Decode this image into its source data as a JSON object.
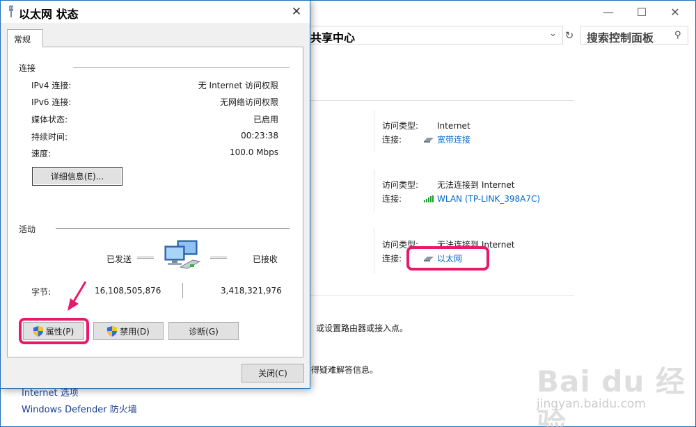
{
  "background_window": {
    "address": "共享中心",
    "search_placeholder": "搜索控制面板",
    "controls": {
      "minimize": "—",
      "maximize": "☐",
      "close": "✕"
    },
    "networks": [
      {
        "access_type_label": "访问类型:",
        "access_type": "Internet",
        "connection_label": "连接:",
        "connection": "宽带连接",
        "icon": "broadband-icon"
      },
      {
        "access_type_label": "访问类型:",
        "access_type": "无法连接到 Internet",
        "connection_label": "连接:",
        "connection": "WLAN (TP-LINK_398A7C)",
        "icon": "wifi-signal-icon"
      },
      {
        "access_type_label": "访问类型:",
        "access_type": "无法连接到 Internet",
        "connection_label": "连接:",
        "connection": "以太网",
        "icon": "ethernet-icon"
      }
    ],
    "setup_text": "或设置路由器或接入点。",
    "troubleshoot_text": "得疑难解答信息。",
    "sidebar_links": [
      "Internet 选项",
      "Windows Defender 防火墙"
    ],
    "watermark": {
      "brand": "Bai du 经验",
      "url": "jingyan.baidu.com"
    }
  },
  "dialog": {
    "title": "以太网 状态",
    "close_glyph": "✕",
    "tab": "常规",
    "connection_group": "连接",
    "info": [
      {
        "label": "IPv4 连接:",
        "value": "无 Internet 访问权限"
      },
      {
        "label": "IPv6 连接:",
        "value": "无网络访问权限"
      },
      {
        "label": "媒体状态:",
        "value": "已启用"
      },
      {
        "label": "持续时间:",
        "value": "00:23:38"
      },
      {
        "label": "速度:",
        "value": "100.0 Mbps"
      }
    ],
    "details_button": "详细信息(E)...",
    "activity_group": "活动",
    "sent_label": "已发送",
    "received_label": "已接收",
    "bytes_label": "字节:",
    "bytes_sent": "16,108,505,876",
    "bytes_received": "3,418,321,976",
    "properties_button": "属性(P)",
    "disable_button": "禁用(D)",
    "diagnose_button": "诊断(G)",
    "close_button": "关闭(C)",
    "accent_color": "#e8196b"
  }
}
